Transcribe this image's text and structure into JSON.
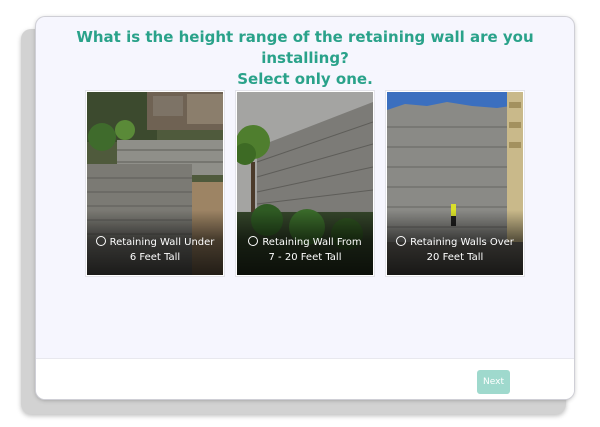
{
  "question": {
    "line1": "What is the height range of the retaining wall are you installing?",
    "line2": "Select only one."
  },
  "options": [
    {
      "line1": "Retaining Wall Under",
      "line2": "6 Feet Tall",
      "image": "short-stone-wall-photo"
    },
    {
      "line1": "Retaining Wall From",
      "line2": "7 - 20 Feet Tall",
      "image": "medium-stone-wall-photo"
    },
    {
      "line1": "Retaining Walls Over",
      "line2": "20 Feet Tall",
      "image": "tall-stone-wall-photo"
    }
  ],
  "footer": {
    "next_label": "Next"
  },
  "colors": {
    "accent": "#2aa28a",
    "next_button": "#9fd9cd",
    "card_bg": "#f6f6fe"
  }
}
